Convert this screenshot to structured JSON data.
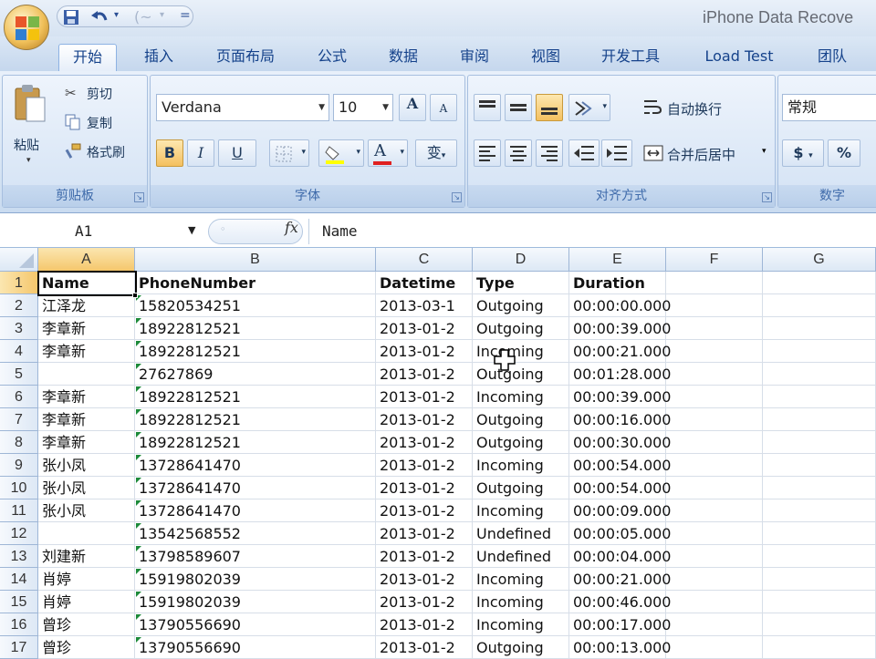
{
  "window": {
    "title": "iPhone Data Recove"
  },
  "quick_access": {
    "redo_label": "(~",
    "customize_label": "="
  },
  "tabs": [
    {
      "label": "开始",
      "active": true
    },
    {
      "label": "插入"
    },
    {
      "label": "页面布局"
    },
    {
      "label": "公式"
    },
    {
      "label": "数据"
    },
    {
      "label": "审阅"
    },
    {
      "label": "视图"
    },
    {
      "label": "开发工具"
    },
    {
      "label": "Load Test"
    },
    {
      "label": "团队"
    }
  ],
  "clipboard": {
    "paste": "粘贴",
    "cut": "剪切",
    "copy": "复制",
    "format_painter": "格式刷",
    "group_label": "剪贴板"
  },
  "font": {
    "family": "Verdana",
    "size": "10",
    "grow": "A",
    "shrink": "A",
    "bold": "B",
    "italic": "I",
    "underline": "U",
    "color_letter": "A",
    "phonetic": "变",
    "group_label": "字体"
  },
  "alignment": {
    "wrap_text": "自动换行",
    "merge_center": "合并后居中",
    "group_label": "对齐方式"
  },
  "number": {
    "format": "常规",
    "currency": "$",
    "percent": "%",
    "group_label": "数字"
  },
  "formula_bar": {
    "name_box": "A1",
    "fx": "fx",
    "content": "Name"
  },
  "grid": {
    "columns": [
      "A",
      "B",
      "C",
      "D",
      "E",
      "F",
      "G"
    ],
    "selected_cell": "A1",
    "headers": [
      "Name",
      "PhoneNumber",
      "Datetime",
      "Type",
      "Duration"
    ],
    "rows": [
      {
        "row": "2",
        "name": "江泽龙",
        "phone": "15820534251",
        "datetime": "2013-03-1",
        "type": "Outgoing",
        "duration": "00:00:00.000"
      },
      {
        "row": "3",
        "name": "李章新",
        "phone": "18922812521",
        "datetime": "2013-01-2",
        "type": "Outgoing",
        "duration": "00:00:39.000"
      },
      {
        "row": "4",
        "name": "李章新",
        "phone": "18922812521",
        "datetime": "2013-01-2",
        "type": "Incoming",
        "duration": "00:00:21.000"
      },
      {
        "row": "5",
        "name": "",
        "phone": "27627869",
        "datetime": "2013-01-2",
        "type": "Outgoing",
        "duration": "00:01:28.000"
      },
      {
        "row": "6",
        "name": "李章新",
        "phone": "18922812521",
        "datetime": "2013-01-2",
        "type": "Incoming",
        "duration": "00:00:39.000"
      },
      {
        "row": "7",
        "name": "李章新",
        "phone": "18922812521",
        "datetime": "2013-01-2",
        "type": "Outgoing",
        "duration": "00:00:16.000"
      },
      {
        "row": "8",
        "name": "李章新",
        "phone": "18922812521",
        "datetime": "2013-01-2",
        "type": "Outgoing",
        "duration": "00:00:30.000"
      },
      {
        "row": "9",
        "name": "张小凤",
        "phone": "13728641470",
        "datetime": "2013-01-2",
        "type": "Incoming",
        "duration": "00:00:54.000"
      },
      {
        "row": "10",
        "name": "张小凤",
        "phone": "13728641470",
        "datetime": "2013-01-2",
        "type": "Outgoing",
        "duration": "00:00:54.000"
      },
      {
        "row": "11",
        "name": "张小凤",
        "phone": "13728641470",
        "datetime": "2013-01-2",
        "type": "Incoming",
        "duration": "00:00:09.000"
      },
      {
        "row": "12",
        "name": "",
        "phone": "13542568552",
        "datetime": "2013-01-2",
        "type": "Undefined",
        "duration": "00:00:05.000"
      },
      {
        "row": "13",
        "name": "刘建新",
        "phone": "13798589607",
        "datetime": "2013-01-2",
        "type": "Undefined",
        "duration": "00:00:04.000"
      },
      {
        "row": "14",
        "name": "肖婷",
        "phone": "15919802039",
        "datetime": "2013-01-2",
        "type": "Incoming",
        "duration": "00:00:21.000"
      },
      {
        "row": "15",
        "name": "肖婷",
        "phone": "15919802039",
        "datetime": "2013-01-2",
        "type": "Incoming",
        "duration": "00:00:46.000"
      },
      {
        "row": "16",
        "name": "曾珍",
        "phone": "13790556690",
        "datetime": "2013-01-2",
        "type": "Incoming",
        "duration": "00:00:17.000"
      },
      {
        "row": "17",
        "name": "曾珍",
        "phone": "13790556690",
        "datetime": "2013-01-2",
        "type": "Outgoing",
        "duration": "00:00:13.000"
      }
    ]
  },
  "colors": {
    "tab_text": "#15428b",
    "ribbon_bg": "#d9e6f5",
    "selection_header": "#f5c76c",
    "text_indicator": "#1d8a3a"
  }
}
